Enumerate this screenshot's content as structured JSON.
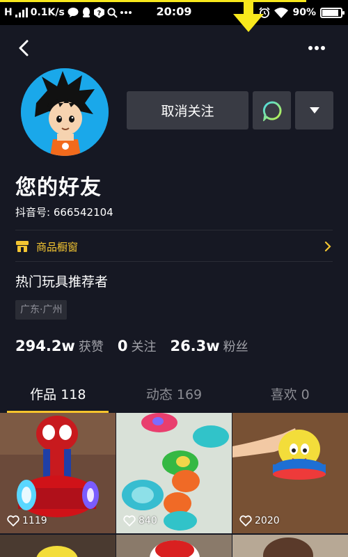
{
  "status_bar": {
    "carrier": "H",
    "network_speed": "0.1K/s",
    "time": "20:09",
    "battery": "90%",
    "battery_level": 0.9
  },
  "header": {
    "back_icon": "chevron-left-icon",
    "more_icon": "more-horizontal-icon"
  },
  "profile": {
    "avatar_icon": "cartoon-avatar",
    "unfollow_label": "取消关注",
    "message_icon": "chat-bubble-icon",
    "dropdown_icon": "triangle-down-icon",
    "nickname": "您的好友",
    "douyin_id": "抖音号: 666542104",
    "shop_label": "商品橱窗",
    "bio": "热门玩具推荐者",
    "location": "广东·广州"
  },
  "stats": [
    {
      "value": "294.2w",
      "label": "获赞"
    },
    {
      "value": "0",
      "label": "关注"
    },
    {
      "value": "26.3w",
      "label": "粉丝"
    }
  ],
  "tabs": [
    {
      "label": "作品 118"
    },
    {
      "label": "动态 169"
    },
    {
      "label": "喜欢 0"
    }
  ],
  "videos": [
    {
      "likes": "1119"
    },
    {
      "likes": "840"
    },
    {
      "likes": "2020"
    }
  ],
  "colors": {
    "background": "#161823",
    "accent": "#f8c42c",
    "button": "#393b44",
    "highlight_arrow": "#f8e81c"
  }
}
